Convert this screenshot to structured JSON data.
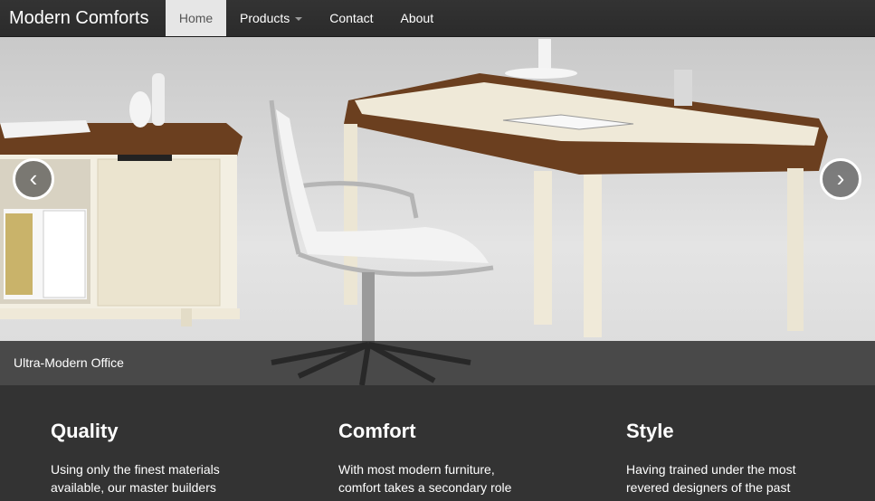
{
  "nav": {
    "brand": "Modern Comforts",
    "items": [
      {
        "label": "Home",
        "active": true
      },
      {
        "label": "Products",
        "dropdown": true
      },
      {
        "label": "Contact"
      },
      {
        "label": "About"
      }
    ]
  },
  "carousel": {
    "caption": "Ultra-Modern Office",
    "prev_icon": "chevron-left-icon",
    "next_icon": "chevron-right-icon",
    "prev_glyph": "‹",
    "next_glyph": "›"
  },
  "features": [
    {
      "title": "Quality",
      "text": "Using only the finest materials available, our master builders"
    },
    {
      "title": "Comfort",
      "text": "With most modern furniture, comfort takes a secondary role"
    },
    {
      "title": "Style",
      "text": "Having trained under the most revered designers of the past"
    }
  ],
  "colors": {
    "navbar": "#333333",
    "active_tab": "#e6e6e6",
    "footer_bg": "#333333",
    "wood": "#6b3f1f",
    "cream": "#efe9d8"
  }
}
